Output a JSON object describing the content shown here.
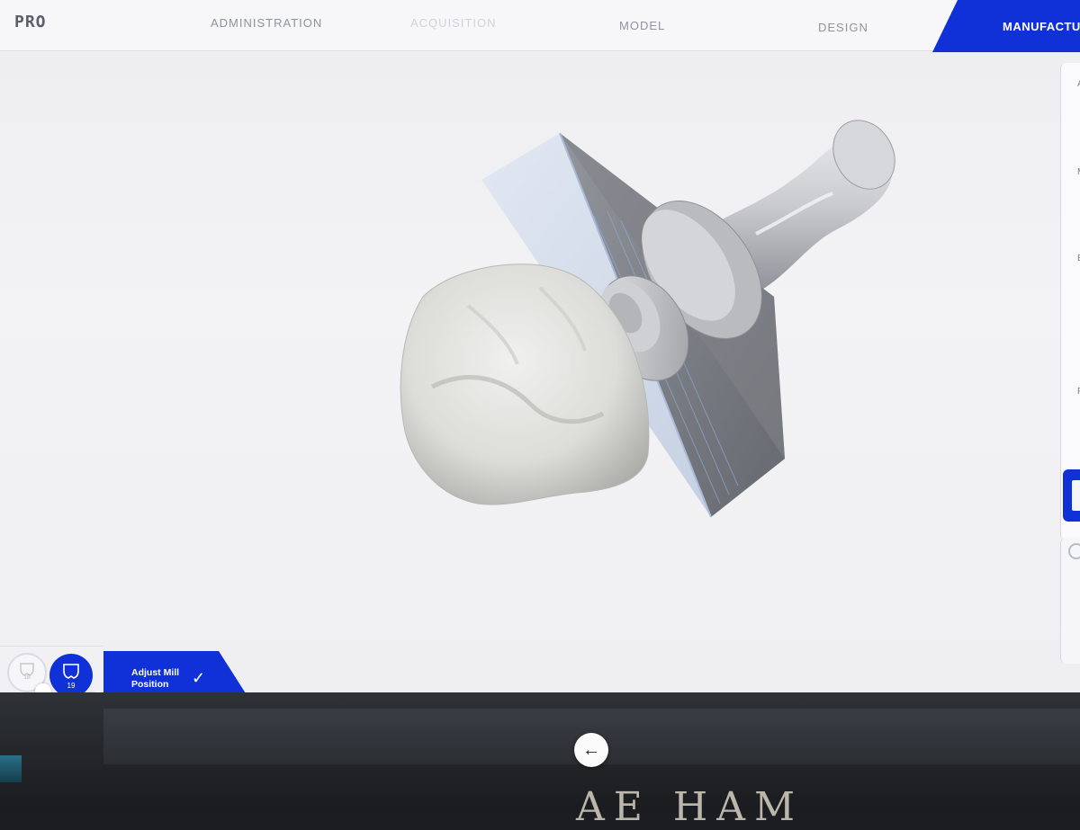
{
  "app": {
    "logo_text": "PRO"
  },
  "nav": {
    "steps": [
      {
        "label": "ADMINISTRATION",
        "state": "done"
      },
      {
        "label": "ACQUISITION",
        "state": "faded"
      },
      {
        "label": "MODEL",
        "state": "pending"
      },
      {
        "label": "DESIGN",
        "state": "pending"
      },
      {
        "label": "MANUFACTU",
        "state": "active"
      }
    ]
  },
  "right_panel": {
    "labels": [
      "A",
      "M",
      "E",
      "F"
    ]
  },
  "bottom": {
    "tooth_slot_number": "18",
    "active_tooth_number": "19",
    "step_label": "Adjust Mill Position",
    "step_check_icon": "checkmark-icon"
  },
  "back_button": {
    "icon": "arrow-left-icon",
    "glyph": "←"
  },
  "desk_sign_text": "AE HAM",
  "colors": {
    "accent": "#1131d8",
    "background": "#efeff2",
    "nav_text": "#8d93a0"
  }
}
